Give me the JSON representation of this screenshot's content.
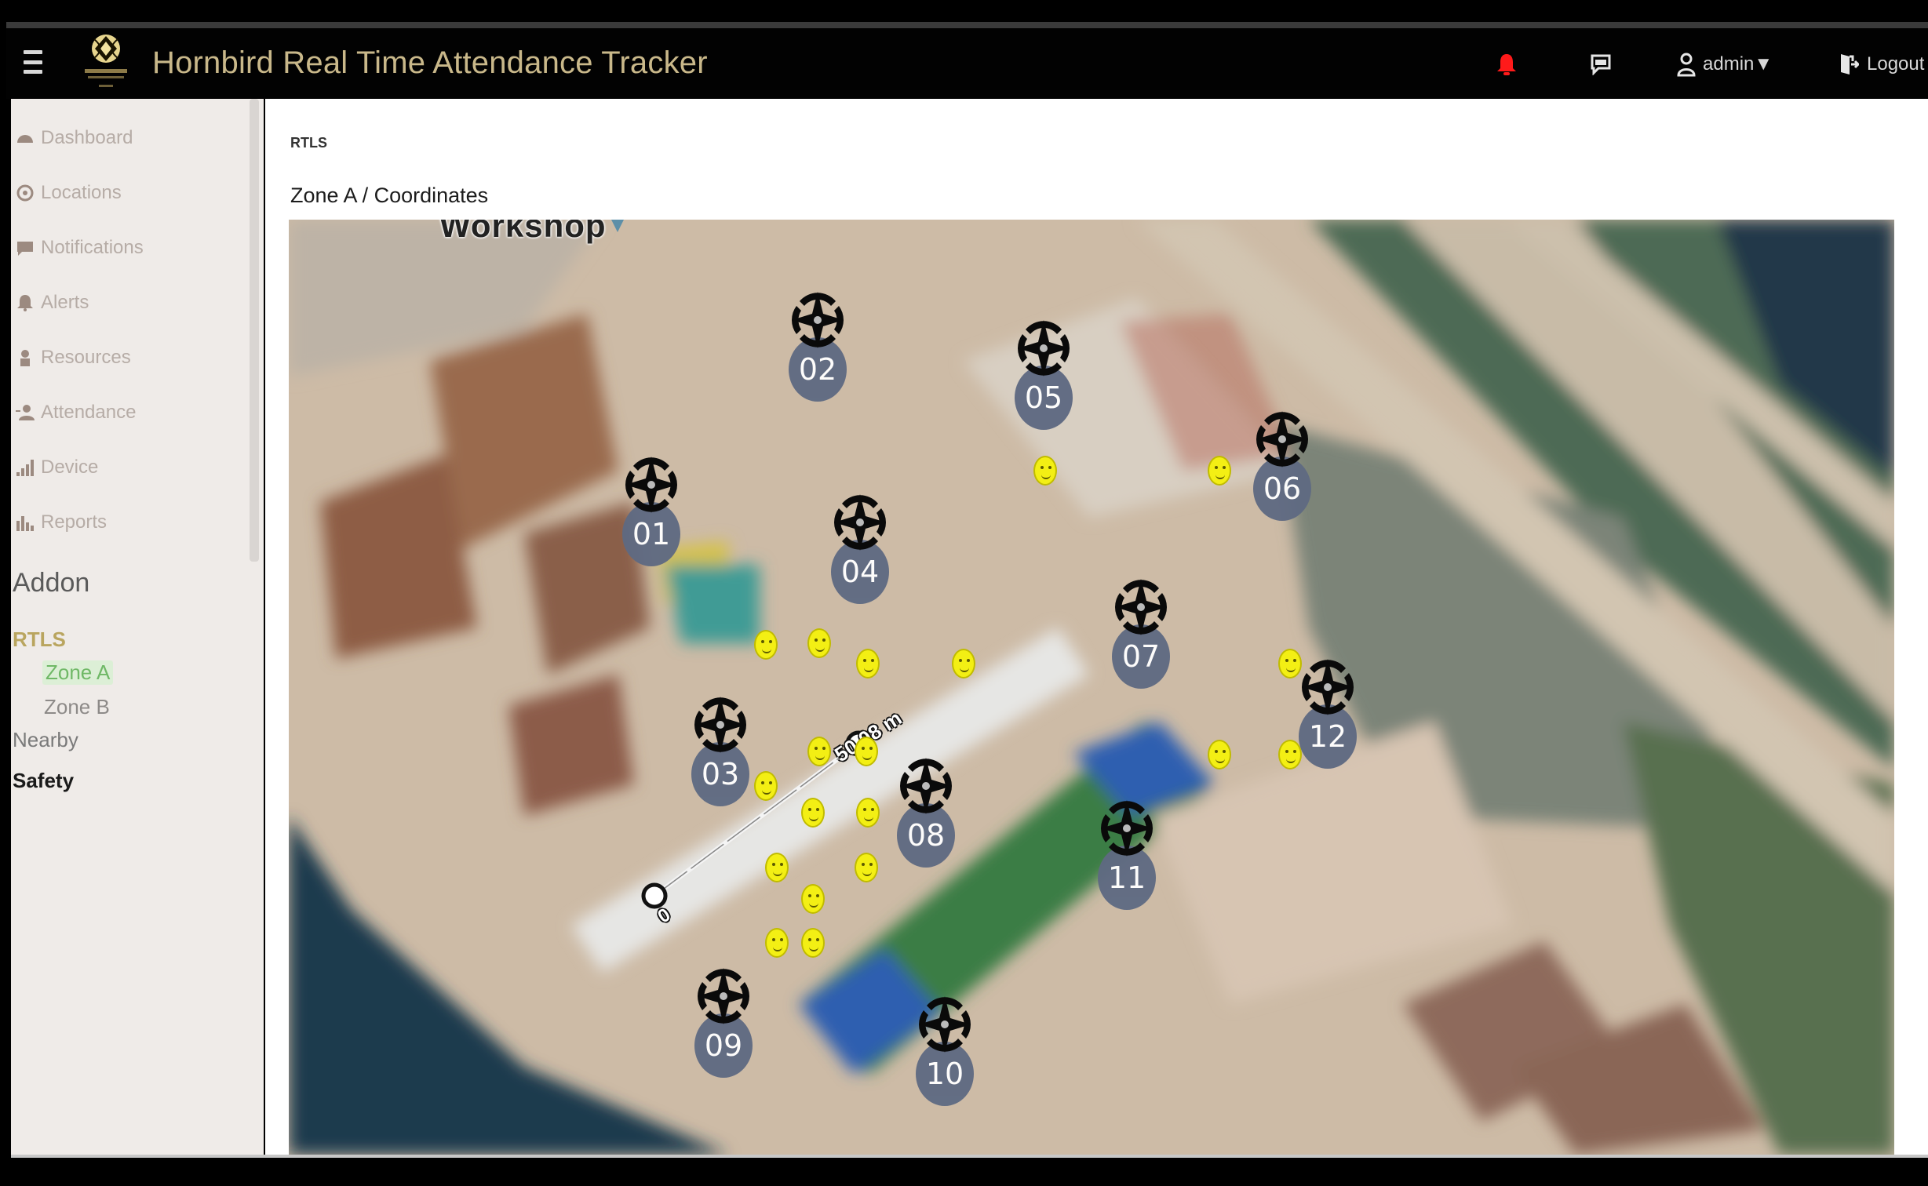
{
  "header": {
    "title": "Hornbird Real Time Attendance Tracker",
    "icons": {
      "menu": "hamburger-menu-icon",
      "alarm": "alarm-bell-icon",
      "messages": "chat-icon",
      "user": "user-icon",
      "logout": "logout-icon"
    },
    "user_label": "admin▼",
    "logout_label": "Logout",
    "accent_color": "#c9b88a",
    "alarm_color": "#ff1a1a"
  },
  "sidebar": {
    "items": [
      {
        "label": "Dashboard",
        "icon": "dashboard-icon"
      },
      {
        "label": "Locations",
        "icon": "locations-icon"
      },
      {
        "label": "Notifications",
        "icon": "notifications-icon"
      },
      {
        "label": "Alerts",
        "icon": "bell-icon"
      },
      {
        "label": "Resources",
        "icon": "resources-icon"
      },
      {
        "label": "Attendance",
        "icon": "attendance-icon"
      },
      {
        "label": "Device",
        "icon": "signal-icon"
      },
      {
        "label": "Reports",
        "icon": "bar-chart-icon"
      }
    ],
    "addon_title": "Addon",
    "rtls_label": "RTLS",
    "zones": [
      {
        "label": "Zone A",
        "active": true
      },
      {
        "label": "Zone B",
        "active": false
      }
    ],
    "nearby_label": "Nearby",
    "safety_label": "Safety",
    "active_color": "#6fb866"
  },
  "main": {
    "breadcrumb": "RTLS",
    "title": "Zone A / Coordinates",
    "map": {
      "place_label": "Workshop",
      "measure_label": "50.08 m",
      "measure_start_label": "0",
      "anchors": [
        "01",
        "02",
        "03",
        "04",
        "05",
        "06",
        "07",
        "08",
        "09",
        "10",
        "11",
        "12"
      ],
      "tag_count": 22
    }
  }
}
